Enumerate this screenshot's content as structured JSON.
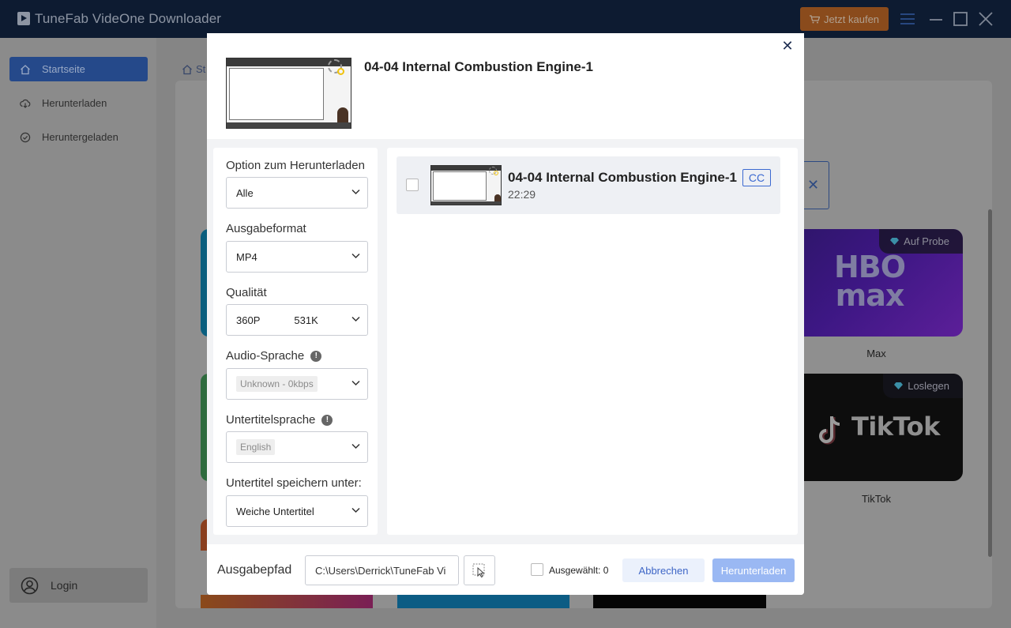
{
  "app": {
    "title": "TuneFab VideOne Downloader",
    "buy_label": "Jetzt kaufen",
    "icons": [
      "app-logo-icon",
      "cart-icon",
      "menu-icon",
      "minimize-icon",
      "maximize-icon",
      "close-icon"
    ]
  },
  "sidebar": {
    "items": [
      {
        "label": "Startseite",
        "icon": "home-icon",
        "active": true
      },
      {
        "label": "Herunterladen",
        "icon": "cloud-download-icon",
        "active": false
      },
      {
        "label": "Heruntergeladen",
        "icon": "check-circle-icon",
        "active": false
      }
    ],
    "login_label": "Login"
  },
  "background": {
    "breadcrumb": "St",
    "services": [
      {
        "name": "Max",
        "badge": "Auf Probe",
        "logo_text": "HBO max"
      },
      {
        "name": "TikTok",
        "badge": "Loslegen",
        "logo_text": "TikTok"
      }
    ]
  },
  "dialog": {
    "title": "04-04 Internal Combustion Engine-1",
    "options": {
      "download_option": {
        "label": "Option zum Herunterladen",
        "value": "Alle"
      },
      "output_format": {
        "label": "Ausgabeformat",
        "value": "MP4"
      },
      "quality": {
        "label": "Qualität",
        "resolution": "360P",
        "bitrate": "531K"
      },
      "audio_language": {
        "label": "Audio-Sprache",
        "value": "Unknown - 0kbps"
      },
      "subtitle_language": {
        "label": "Untertitelsprache",
        "value": "English"
      },
      "subtitle_save_as": {
        "label": "Untertitel speichern unter:",
        "value": "Weiche Untertitel"
      }
    },
    "video": {
      "title": "04-04 Internal Combustion Engine-1",
      "badge": "CC",
      "duration": "22:29",
      "checked": false
    },
    "footer": {
      "path_label": "Ausgabepfad",
      "path_value": "C:\\Users\\Derrick\\TuneFab Vi",
      "selected_label": "Ausgewählt: 0",
      "cancel_label": "Abbrechen",
      "download_label": "Herunterladen"
    }
  },
  "colors": {
    "accent": "#3e66c6",
    "download_button": "#9ab8f3",
    "titlebar": "#0d1b31",
    "buy_button": "#8a4b1c"
  }
}
